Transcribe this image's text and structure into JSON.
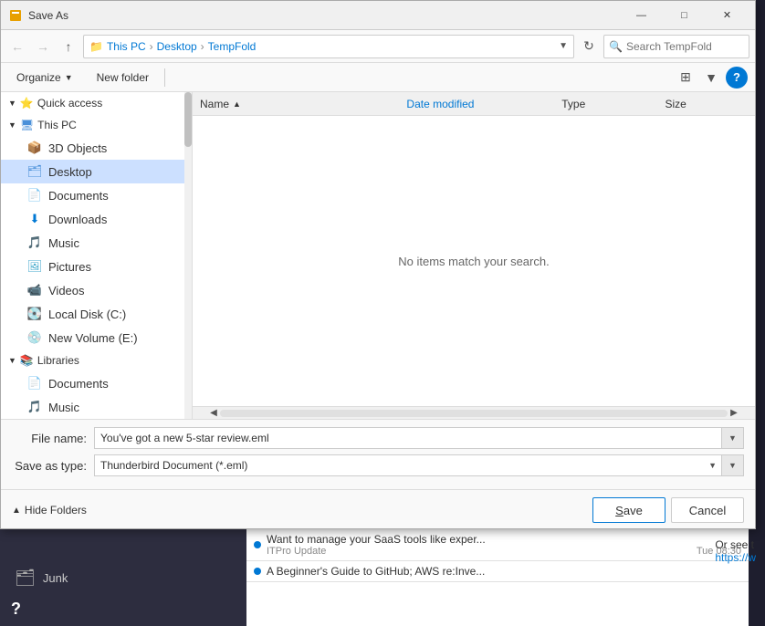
{
  "dialog": {
    "title": "Save As",
    "breadcrumb": {
      "parts": [
        "This PC",
        "Desktop",
        "TempFold"
      ]
    },
    "search_placeholder": "Search TempFold",
    "toolbar": {
      "organize_label": "Organize",
      "new_folder_label": "New folder"
    },
    "columns": {
      "name": "Name",
      "date_modified": "Date modified",
      "type": "Type",
      "size": "Size"
    },
    "no_items_text": "No items match your search.",
    "sidebar": {
      "quick_access_label": "Quick access",
      "this_pc_label": "This PC",
      "items_under_this_pc": [
        {
          "label": "3D Objects",
          "icon": "folder"
        },
        {
          "label": "Desktop",
          "icon": "folder-desktop",
          "selected": true
        },
        {
          "label": "Documents",
          "icon": "folder-docs"
        },
        {
          "label": "Downloads",
          "icon": "downloads"
        },
        {
          "label": "Music",
          "icon": "music"
        },
        {
          "label": "Pictures",
          "icon": "pictures"
        },
        {
          "label": "Videos",
          "icon": "videos"
        },
        {
          "label": "Local Disk (C:)",
          "icon": "disk"
        },
        {
          "label": "New Volume (E:)",
          "icon": "disk"
        }
      ],
      "libraries_label": "Libraries",
      "libraries_items": [
        {
          "label": "Documents",
          "icon": "folder-docs"
        },
        {
          "label": "Music",
          "icon": "music"
        }
      ]
    },
    "form": {
      "file_name_label": "File name:",
      "file_name_value": "You've got a new 5-star review.eml",
      "save_as_type_label": "Save as type:",
      "save_as_type_value": "Thunderbird Document (*.eml)"
    },
    "buttons": {
      "save_label": "Save",
      "cancel_label": "Cancel",
      "hide_folders_label": "Hide Folders"
    }
  },
  "background": {
    "junk_label": "Junk",
    "email1": "Want to manage your SaaS tools like exper...",
    "email1_sender": "ITPro Update",
    "email1_time": "Tue 08:30",
    "email2": "A Beginner's Guide to GitHub; AWS re:Inve...",
    "or_see_text": "Or see t",
    "link_text": "https://w"
  }
}
